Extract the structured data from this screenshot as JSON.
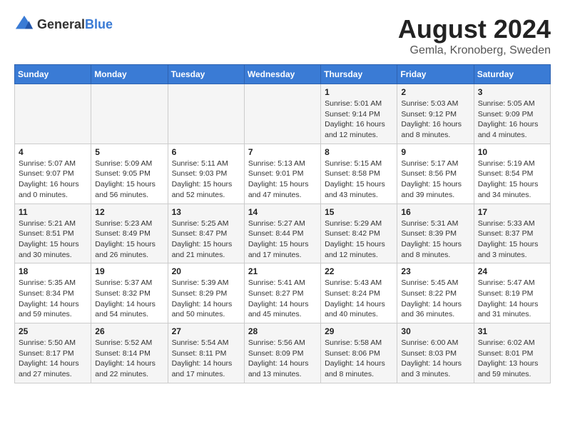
{
  "logo": {
    "text_general": "General",
    "text_blue": "Blue"
  },
  "title": {
    "month_year": "August 2024",
    "location": "Gemla, Kronoberg, Sweden"
  },
  "days_of_week": [
    "Sunday",
    "Monday",
    "Tuesday",
    "Wednesday",
    "Thursday",
    "Friday",
    "Saturday"
  ],
  "weeks": [
    [
      {
        "day": "",
        "info": ""
      },
      {
        "day": "",
        "info": ""
      },
      {
        "day": "",
        "info": ""
      },
      {
        "day": "",
        "info": ""
      },
      {
        "day": "1",
        "info": "Sunrise: 5:01 AM\nSunset: 9:14 PM\nDaylight: 16 hours\nand 12 minutes."
      },
      {
        "day": "2",
        "info": "Sunrise: 5:03 AM\nSunset: 9:12 PM\nDaylight: 16 hours\nand 8 minutes."
      },
      {
        "day": "3",
        "info": "Sunrise: 5:05 AM\nSunset: 9:09 PM\nDaylight: 16 hours\nand 4 minutes."
      }
    ],
    [
      {
        "day": "4",
        "info": "Sunrise: 5:07 AM\nSunset: 9:07 PM\nDaylight: 16 hours\nand 0 minutes."
      },
      {
        "day": "5",
        "info": "Sunrise: 5:09 AM\nSunset: 9:05 PM\nDaylight: 15 hours\nand 56 minutes."
      },
      {
        "day": "6",
        "info": "Sunrise: 5:11 AM\nSunset: 9:03 PM\nDaylight: 15 hours\nand 52 minutes."
      },
      {
        "day": "7",
        "info": "Sunrise: 5:13 AM\nSunset: 9:01 PM\nDaylight: 15 hours\nand 47 minutes."
      },
      {
        "day": "8",
        "info": "Sunrise: 5:15 AM\nSunset: 8:58 PM\nDaylight: 15 hours\nand 43 minutes."
      },
      {
        "day": "9",
        "info": "Sunrise: 5:17 AM\nSunset: 8:56 PM\nDaylight: 15 hours\nand 39 minutes."
      },
      {
        "day": "10",
        "info": "Sunrise: 5:19 AM\nSunset: 8:54 PM\nDaylight: 15 hours\nand 34 minutes."
      }
    ],
    [
      {
        "day": "11",
        "info": "Sunrise: 5:21 AM\nSunset: 8:51 PM\nDaylight: 15 hours\nand 30 minutes."
      },
      {
        "day": "12",
        "info": "Sunrise: 5:23 AM\nSunset: 8:49 PM\nDaylight: 15 hours\nand 26 minutes."
      },
      {
        "day": "13",
        "info": "Sunrise: 5:25 AM\nSunset: 8:47 PM\nDaylight: 15 hours\nand 21 minutes."
      },
      {
        "day": "14",
        "info": "Sunrise: 5:27 AM\nSunset: 8:44 PM\nDaylight: 15 hours\nand 17 minutes."
      },
      {
        "day": "15",
        "info": "Sunrise: 5:29 AM\nSunset: 8:42 PM\nDaylight: 15 hours\nand 12 minutes."
      },
      {
        "day": "16",
        "info": "Sunrise: 5:31 AM\nSunset: 8:39 PM\nDaylight: 15 hours\nand 8 minutes."
      },
      {
        "day": "17",
        "info": "Sunrise: 5:33 AM\nSunset: 8:37 PM\nDaylight: 15 hours\nand 3 minutes."
      }
    ],
    [
      {
        "day": "18",
        "info": "Sunrise: 5:35 AM\nSunset: 8:34 PM\nDaylight: 14 hours\nand 59 minutes."
      },
      {
        "day": "19",
        "info": "Sunrise: 5:37 AM\nSunset: 8:32 PM\nDaylight: 14 hours\nand 54 minutes."
      },
      {
        "day": "20",
        "info": "Sunrise: 5:39 AM\nSunset: 8:29 PM\nDaylight: 14 hours\nand 50 minutes."
      },
      {
        "day": "21",
        "info": "Sunrise: 5:41 AM\nSunset: 8:27 PM\nDaylight: 14 hours\nand 45 minutes."
      },
      {
        "day": "22",
        "info": "Sunrise: 5:43 AM\nSunset: 8:24 PM\nDaylight: 14 hours\nand 40 minutes."
      },
      {
        "day": "23",
        "info": "Sunrise: 5:45 AM\nSunset: 8:22 PM\nDaylight: 14 hours\nand 36 minutes."
      },
      {
        "day": "24",
        "info": "Sunrise: 5:47 AM\nSunset: 8:19 PM\nDaylight: 14 hours\nand 31 minutes."
      }
    ],
    [
      {
        "day": "25",
        "info": "Sunrise: 5:50 AM\nSunset: 8:17 PM\nDaylight: 14 hours\nand 27 minutes."
      },
      {
        "day": "26",
        "info": "Sunrise: 5:52 AM\nSunset: 8:14 PM\nDaylight: 14 hours\nand 22 minutes."
      },
      {
        "day": "27",
        "info": "Sunrise: 5:54 AM\nSunset: 8:11 PM\nDaylight: 14 hours\nand 17 minutes."
      },
      {
        "day": "28",
        "info": "Sunrise: 5:56 AM\nSunset: 8:09 PM\nDaylight: 14 hours\nand 13 minutes."
      },
      {
        "day": "29",
        "info": "Sunrise: 5:58 AM\nSunset: 8:06 PM\nDaylight: 14 hours\nand 8 minutes."
      },
      {
        "day": "30",
        "info": "Sunrise: 6:00 AM\nSunset: 8:03 PM\nDaylight: 14 hours\nand 3 minutes."
      },
      {
        "day": "31",
        "info": "Sunrise: 6:02 AM\nSunset: 8:01 PM\nDaylight: 13 hours\nand 59 minutes."
      }
    ]
  ]
}
